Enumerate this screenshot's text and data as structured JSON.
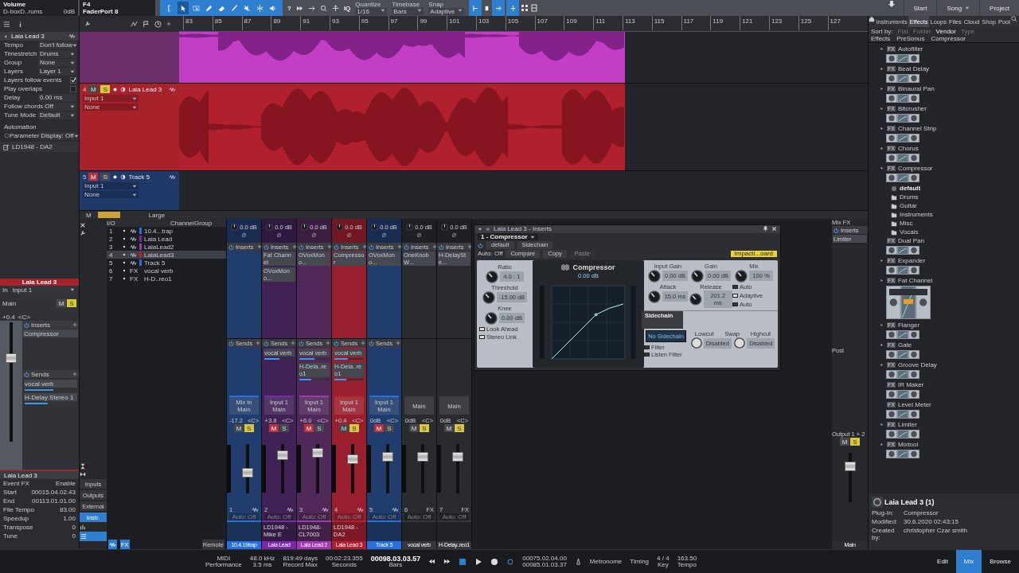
{
  "toolbar": {
    "track_label": "Volume",
    "track_device": "D-boxD..rums",
    "track_gain": "0dB",
    "control_key": "F4",
    "controller": "FaderPort 8",
    "tools": [
      {
        "kind": "bracket",
        "selected": false
      },
      {
        "kind": "arrow",
        "selected": true
      },
      {
        "kind": "range",
        "selected": false
      },
      {
        "kind": "pencil",
        "selected": false
      },
      {
        "kind": "eraser",
        "selected": false
      },
      {
        "kind": "paint",
        "selected": false
      },
      {
        "kind": "mute",
        "selected": false
      },
      {
        "kind": "split",
        "selected": false
      },
      {
        "kind": "listen",
        "selected": false
      }
    ],
    "help": "?",
    "iq": "IQ",
    "settings": [
      {
        "label": "Quantize",
        "value": "1/16"
      },
      {
        "label": "Timebase",
        "value": "Bars"
      },
      {
        "label": "Snap",
        "value": "Adaptive"
      }
    ],
    "nav": [
      {
        "label": "Start",
        "dropdown": false
      },
      {
        "label": "Song",
        "dropdown": true
      },
      {
        "label": "Project",
        "dropdown": false
      }
    ]
  },
  "ruler": {
    "bars": [
      "83",
      "85",
      "87",
      "89",
      "91",
      "93",
      "95",
      "97",
      "99",
      "101",
      "103",
      "105",
      "107",
      "109",
      "111",
      "113",
      "115",
      "117",
      "119",
      "121",
      "123",
      "125",
      "127"
    ]
  },
  "inspector": {
    "title": "Laia Lead 3",
    "rows": [
      {
        "label": "Tempo",
        "value": "Don't follow",
        "kind": "dropdown"
      },
      {
        "label": "Timestretch",
        "value": "Drums",
        "kind": "dropdown"
      },
      {
        "label": "Group",
        "value": "None",
        "kind": "dropdown"
      },
      {
        "label": "Layers",
        "value": "Layer 1",
        "kind": "dropdown"
      },
      {
        "label": "Layers follow events",
        "kind": "check",
        "checked": true
      },
      {
        "label": "Play overlaps",
        "kind": "check",
        "checked": false
      },
      {
        "label": "Delay",
        "value": "0.00 ms",
        "kind": "text"
      },
      {
        "label": "Follow chords",
        "value": "Off",
        "kind": "dropdown"
      },
      {
        "label": "Tune Mode",
        "value": "Default",
        "kind": "dropdown"
      }
    ],
    "automation_label": "Automation",
    "parameter_label": "Parameter",
    "parameter_value": "Display: Off",
    "event": "LD1948 - DA2"
  },
  "channel_inspector": {
    "title": "Laia Lead 3",
    "in_label": "In",
    "input": "Input 1",
    "output": "Main",
    "volume": "+0.4",
    "pan": "<C>",
    "mute_label": "M",
    "solo_label": "S",
    "mute": false,
    "solo": true,
    "level": 0.7,
    "inserts_label": "Inserts",
    "inserts": [
      "Compressor"
    ],
    "sends_label": "Sends",
    "sends": [
      {
        "name": "vocal verb",
        "level": 0.55
      },
      {
        "name": "H-Delay Stereo 1",
        "level": 0.45
      }
    ]
  },
  "event_inspector": {
    "title": "Laia Lead 3",
    "rows": [
      {
        "label": "Event FX",
        "value": "Enable"
      },
      {
        "label": "Start",
        "value": "00015.04.02.43"
      },
      {
        "label": "End",
        "value": "00113.01.01.00"
      },
      {
        "label": "File Tempo",
        "value": "83.00"
      },
      {
        "label": "Speedup",
        "value": "1.00"
      },
      {
        "label": "Transpose",
        "value": "0"
      },
      {
        "label": "Tune",
        "value": "0"
      }
    ]
  },
  "tracks": [
    {
      "kind": "partial",
      "color": "#c23ec4"
    },
    {
      "kind": "audio",
      "number": "4",
      "name": "Laia Lead 3",
      "color": "#a8222c",
      "mute_label": "M",
      "solo_label": "S",
      "mute": false,
      "solo": true,
      "input": "Input 1",
      "output": "None"
    },
    {
      "kind": "audio",
      "number": "5",
      "name": "Track 5",
      "color": "#1f3a68",
      "mute_label": "M",
      "solo_label": "S",
      "mute": true,
      "solo": false,
      "input": "Input 1",
      "output": "None"
    }
  ],
  "mixer_bar": {
    "left": "M",
    "size": "Large"
  },
  "channel_list": {
    "io": "I/O",
    "headers": [
      "Channel",
      "Group"
    ],
    "rows": [
      {
        "number": "1",
        "name": "10.4...trap",
        "kind": "audio",
        "color": "#2a6fe0",
        "selected": false
      },
      {
        "number": "2",
        "name": "Laia Lead",
        "kind": "audio",
        "color": "#7a2aa8",
        "selected": false
      },
      {
        "number": "3",
        "name": "LaiaLead2",
        "kind": "audio",
        "color": "#a03ab0",
        "selected": false
      },
      {
        "number": "4",
        "name": "LaiaLead3",
        "kind": "audio",
        "color": "#b02030",
        "selected": true
      },
      {
        "number": "5",
        "name": "Track 5",
        "kind": "audio",
        "color": "#2a6fe0",
        "selected": false
      },
      {
        "number": "6",
        "name": "vocal verb",
        "kind": "fx",
        "tag": "FX",
        "selected": false
      },
      {
        "number": "7",
        "name": "H-D..reo1",
        "kind": "fx",
        "tag": "FX",
        "selected": false
      }
    ],
    "buttons": [
      {
        "label": "Inputs",
        "selected": false
      },
      {
        "label": "Outputs",
        "selected": false
      },
      {
        "label": "External",
        "selected": false
      },
      {
        "label": "Instr.",
        "selected": true
      }
    ],
    "fx_button": "FX",
    "remote": "Remote"
  },
  "strips": [
    {
      "kind": "audio",
      "number": "1",
      "name": "10.4.19trap",
      "color": "#2a6fe0",
      "selected": false,
      "gain": "0.0 dB",
      "inserts_label": "Inserts",
      "sends_label": "Sends",
      "in": "Mix In",
      "out": "Main",
      "volume": "-17.2",
      "pan": "<C>",
      "mute_label": "M",
      "solo_label": "S",
      "mute": false,
      "solo": true,
      "level": 0.42,
      "auto": "Auto: Off"
    },
    {
      "kind": "audio",
      "number": "2",
      "name": "Laia Lead",
      "color": "#7a2aa8",
      "selected": false,
      "gain": "0.0 dB",
      "inserts_label": "Inserts",
      "inserts": [
        "Fat Channel",
        "OVoxMono..."
      ],
      "sends_label": "Sends",
      "sends": [
        {
          "name": "vocal verb",
          "level": 0.5
        }
      ],
      "in": "Input 1",
      "out": "Main",
      "volume": "+3.8",
      "pan": "<C>",
      "mute_label": "M",
      "solo_label": "S",
      "mute": true,
      "solo": false,
      "level": 0.78,
      "note": "LD1948 - Mike E",
      "auto": "Auto: Off"
    },
    {
      "kind": "audio",
      "number": "3",
      "name": "Laia Lead 2",
      "color": "#a03ab0",
      "selected": false,
      "gain": "0.0 dB",
      "inserts_label": "Inserts",
      "inserts": [
        "OVoxMono..."
      ],
      "sends_label": "Sends",
      "sends": [
        {
          "name": "vocal verb",
          "level": 0.5
        },
        {
          "name": "H-Dela..reo1",
          "level": 0.4
        }
      ],
      "in": "Input 1",
      "out": "Main",
      "volume": "+6.0",
      "pan": "<C>",
      "mute_label": "M",
      "solo_label": "S",
      "mute": true,
      "solo": false,
      "level": 0.82,
      "note": "LD1948-CL7003",
      "auto": "Auto: Off"
    },
    {
      "kind": "audio",
      "number": "4",
      "name": "Laia Lead 3",
      "color": "#b02030",
      "selected": true,
      "gain": "0.0 dB",
      "inserts_label": "Inserts",
      "inserts": [
        "Compressor"
      ],
      "sends_label": "Sends",
      "sends": [
        {
          "name": "vocal verb",
          "level": 0.45
        },
        {
          "name": "H-Dela..reo1",
          "level": 0.4
        }
      ],
      "in": "Input 1",
      "out": "Main",
      "volume": "+0.4",
      "pan": "<C>",
      "mute_label": "M",
      "solo_label": "S",
      "mute": false,
      "solo": true,
      "level": 0.7,
      "note": "LD1948 - DA2",
      "auto": "Auto: Off"
    },
    {
      "kind": "audio",
      "number": "5",
      "name": "Track 5",
      "color": "#2a6fe0",
      "selected": false,
      "gain": "0.0 dB",
      "inserts_label": "Inserts",
      "inserts": [
        "OVoxMono..."
      ],
      "sends_label": "Sends",
      "in": "Input 1",
      "out": "Main",
      "volume": "0dB",
      "pan": "<C>",
      "mute_label": "M",
      "solo_label": "S",
      "mute": true,
      "solo": false,
      "level": 0.75,
      "auto": "Auto: Off"
    },
    {
      "kind": "fx",
      "number": "6",
      "tag": "FX",
      "name": "vocal verb",
      "color": "#34373d",
      "selected": false,
      "gain": "0.0 dB",
      "inserts_label": "Inserts",
      "inserts": [
        "OneKnobW..."
      ],
      "out": "Main",
      "volume": "0dB",
      "pan": "<C>",
      "mute_label": "M",
      "solo_label": "S",
      "mute": false,
      "solo": true,
      "level": 0.75,
      "auto": "Auto: Off"
    },
    {
      "kind": "fx",
      "number": "7",
      "tag": "FX",
      "name": "H-Delay..reo1",
      "color": "#34373d",
      "selected": false,
      "gain": "0.0 dB",
      "inserts_label": "Inserts",
      "inserts": [
        "H-DelaySte..."
      ],
      "out": "Main",
      "volume": "0dB",
      "pan": "<C>",
      "mute_label": "M",
      "solo_label": "S",
      "mute": false,
      "solo": true,
      "level": 0.75,
      "auto": "Auto: Off"
    }
  ],
  "main_strip": {
    "title": "Mix FX",
    "inserts_label": "Inserts",
    "inserts": [
      "Limiter"
    ],
    "post": "Post",
    "output": "Output 1 + 2",
    "mute_label": "M",
    "solo_label": "S",
    "mute": false,
    "solo": true,
    "level": 0.72,
    "name": "Main"
  },
  "plugin": {
    "title": "Laia Lead 3 - Inserts",
    "slot": "1 - Compressor",
    "preset": "default",
    "sidechain_button": "Sidechain",
    "auto": "Auto: Off",
    "actions": [
      {
        "label": "Compare",
        "disabled": false
      },
      {
        "label": "Copy",
        "disabled": false
      },
      {
        "label": "Paste",
        "disabled": true
      }
    ],
    "badge": "Impacti...oard",
    "name": "Compressor",
    "readout": "0.00 dB",
    "left_knobs": [
      {
        "label": "Ratio",
        "value": "4.0 : 1"
      },
      {
        "label": "Threshold",
        "value": "-15.00 dB"
      },
      {
        "label": "Knee",
        "value": "0.00 dB"
      }
    ],
    "right_knobs": [
      {
        "label": "Input Gain",
        "value": "0.00 dB"
      },
      {
        "label": "Gain",
        "value": "0.00 dB"
      },
      {
        "label": "Mix",
        "value": "100 %"
      },
      {
        "label": "Attack",
        "value": "15.0 ms"
      },
      {
        "label": "Release",
        "value": "201.2 ms"
      }
    ],
    "left_checks": [
      {
        "label": "Look Ahead",
        "checked": true
      },
      {
        "label": "Stereo Link",
        "checked": true
      }
    ],
    "gain_auto": {
      "label": "Auto",
      "checked": false
    },
    "release_checks": [
      {
        "label": "Auto",
        "checked": false
      },
      {
        "label": "Adaptive",
        "checked": true
      }
    ],
    "sidechain": {
      "title": "Sidechain",
      "source": "No Sidechain",
      "checks": [
        {
          "label": "Filter",
          "checked": false
        },
        {
          "label": "Listen Filter",
          "checked": false
        }
      ],
      "lowcut": "Lowcut",
      "swap": "Swap",
      "highcut": "Highcut",
      "lowcut_value": "Disabled",
      "highcut_value": "Disabled"
    }
  },
  "browser": {
    "tabs": [
      {
        "label": "Instruments",
        "selected": false
      },
      {
        "label": "Effects",
        "selected": true
      },
      {
        "label": "Loops",
        "selected": false
      },
      {
        "label": "Files",
        "selected": false
      },
      {
        "label": "Cloud",
        "selected": false
      },
      {
        "label": "Shop",
        "selected": false
      },
      {
        "label": "Pool",
        "selected": false
      }
    ],
    "sort_label": "Sort by:",
    "sort": [
      {
        "label": "Flat",
        "selected": false
      },
      {
        "label": "Folder",
        "selected": false
      },
      {
        "label": "Vendor",
        "selected": true
      },
      {
        "label": "Type",
        "selected": false
      }
    ],
    "path": [
      "Effects",
      "PreSonus",
      "Compressor"
    ],
    "items": [
      {
        "tag": "FX",
        "name": "Autofilter",
        "expandable": true,
        "expanded": false
      },
      {
        "tag": "FX",
        "name": "Beat Delay",
        "expandable": true,
        "expanded": false
      },
      {
        "tag": "FX",
        "name": "Binaural Pan",
        "expandable": true,
        "expanded": false
      },
      {
        "tag": "FX",
        "name": "Bitcrusher",
        "expandable": true,
        "expanded": false
      },
      {
        "tag": "FX",
        "name": "Channel Strip",
        "expandable": true,
        "expanded": false
      },
      {
        "tag": "FX",
        "name": "Chorus",
        "expandable": true,
        "expanded": false
      },
      {
        "tag": "FX",
        "name": "Compressor",
        "expandable": true,
        "expanded": true,
        "children": [
          {
            "kind": "preset",
            "name": "default"
          },
          {
            "kind": "folder",
            "name": "Drums"
          },
          {
            "kind": "folder",
            "name": "Guitar"
          },
          {
            "kind": "folder",
            "name": "Instruments"
          },
          {
            "kind": "folder",
            "name": "Misc"
          },
          {
            "kind": "folder",
            "name": "Vocals"
          }
        ]
      },
      {
        "tag": "FX",
        "name": "Dual Pan",
        "expandable": false
      },
      {
        "tag": "FX",
        "name": "Expander",
        "expandable": true,
        "expanded": false
      },
      {
        "tag": "FX",
        "name": "Fat Channel",
        "expandable": true,
        "expanded": false,
        "large": true
      },
      {
        "tag": "FX",
        "name": "Flanger",
        "expandable": true,
        "expanded": false
      },
      {
        "tag": "FX",
        "name": "Gate",
        "expandable": true,
        "expanded": false
      },
      {
        "tag": "FX",
        "name": "Groove Delay",
        "expandable": true,
        "expanded": false
      },
      {
        "tag": "FX",
        "name": "IR Maker",
        "expandable": false
      },
      {
        "tag": "FX",
        "name": "Level Meter",
        "expandable": false
      },
      {
        "tag": "FX",
        "name": "Limiter",
        "expandable": true,
        "expanded": false
      },
      {
        "tag": "FX",
        "name": "Mixtool",
        "expandable": true,
        "expanded": false
      }
    ],
    "info": {
      "title": "Laia Lead 3 (1)",
      "rows": [
        {
          "label": "Plug-In:",
          "value": "Compressor"
        },
        {
          "label": "Modified:",
          "value": "30.6.2020 02:43:15"
        },
        {
          "label": "Created by:",
          "value": "christopher Czar smith"
        }
      ]
    }
  },
  "transport": {
    "midi": "MIDI",
    "performance": "Performance",
    "rate": "48.0 kHz",
    "latency": "3.5 ms",
    "record_time": "819:49 days",
    "record_label": "Record Max",
    "seconds": "00:02:23.355",
    "seconds_label": "Seconds",
    "bars": "00098.03.03.57",
    "bars_label": "Bars",
    "loop_start": "00075.02.04.00",
    "loop_end": "00085.01.03.37",
    "metronome": "Metronome",
    "timing": "Timing",
    "signature": "4 / 4",
    "key": "Key",
    "tempo": "163.50",
    "tempo_label": "Tempo"
  },
  "views": [
    {
      "label": "Edit",
      "selected": false
    },
    {
      "label": "Mix",
      "selected": true
    },
    {
      "label": "Browse",
      "selected": false
    }
  ]
}
